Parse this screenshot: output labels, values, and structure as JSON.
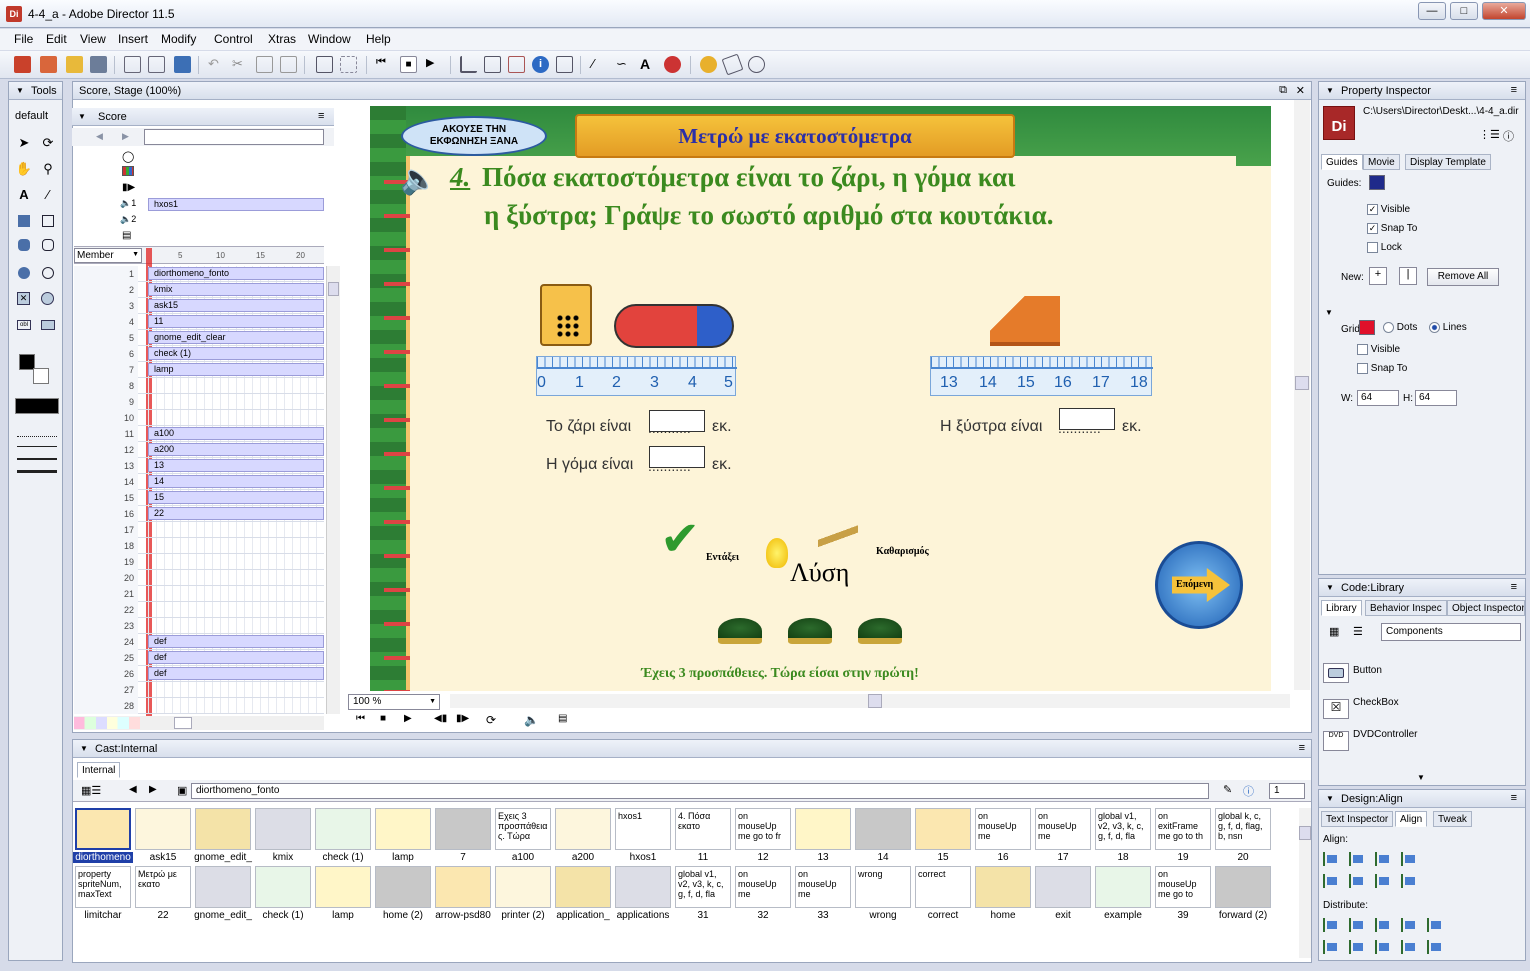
{
  "window": {
    "title": "4-4_a - Adobe Director 11.5",
    "app_icon": "Di"
  },
  "menu": [
    "File",
    "Edit",
    "View",
    "Insert",
    "Modify",
    "Control",
    "Xtras",
    "Window",
    "Help"
  ],
  "tools": {
    "title": "Tools",
    "preset": "default"
  },
  "score": {
    "window_title": "Score, Stage (100%)",
    "panel_title": "Score",
    "member_dropdown": "Member",
    "zoom": "100 %",
    "ruler": [
      "5",
      "10",
      "15",
      "20"
    ],
    "channel_sprite": "hxos1",
    "rows": [
      {
        "n": "1",
        "label": "diorthomeno_fonto"
      },
      {
        "n": "2",
        "label": "kmix"
      },
      {
        "n": "3",
        "label": "ask15"
      },
      {
        "n": "4",
        "label": "11"
      },
      {
        "n": "5",
        "label": "gnome_edit_clear"
      },
      {
        "n": "6",
        "label": "check (1)"
      },
      {
        "n": "7",
        "label": "lamp"
      },
      {
        "n": "8",
        "label": ""
      },
      {
        "n": "9",
        "label": ""
      },
      {
        "n": "10",
        "label": ""
      },
      {
        "n": "11",
        "label": "a100"
      },
      {
        "n": "12",
        "label": "a200"
      },
      {
        "n": "13",
        "label": "13"
      },
      {
        "n": "14",
        "label": "14"
      },
      {
        "n": "15",
        "label": "15"
      },
      {
        "n": "16",
        "label": "22"
      },
      {
        "n": "17",
        "label": ""
      },
      {
        "n": "18",
        "label": ""
      },
      {
        "n": "19",
        "label": ""
      },
      {
        "n": "20",
        "label": ""
      },
      {
        "n": "21",
        "label": ""
      },
      {
        "n": "22",
        "label": ""
      },
      {
        "n": "23",
        "label": ""
      },
      {
        "n": "24",
        "label": "def"
      },
      {
        "n": "25",
        "label": "def"
      },
      {
        "n": "26",
        "label": "def"
      },
      {
        "n": "27",
        "label": ""
      },
      {
        "n": "28",
        "label": ""
      }
    ]
  },
  "stage": {
    "replay_button": "ΑΚΟΥΣΕ ΤΗΝ ΕΚΦΩΝΗΣΗ ΞΑΝΑ",
    "banner": "Μετρώ με εκατοστόμετρα",
    "question_number": "4.",
    "question_line1": "Πόσα εκατοστόμετρα είναι το ζάρι, η γόμα και",
    "question_line2": "η ξύστρα; Γράψε το σωστό αριθμό στα κουτάκια.",
    "ruler_left": [
      "0",
      "1",
      "2",
      "3",
      "4",
      "5"
    ],
    "ruler_right": [
      "13",
      "14",
      "15",
      "16",
      "17",
      "18"
    ],
    "label_die": "Το ζάρι είναι",
    "label_eraser": "Η γόμα είναι",
    "label_sharpener": "Η ξύστρα είναι",
    "dots": "...........",
    "unit": "εκ.",
    "check_label": "Εντάξει",
    "solution_label": "Λύση",
    "clear_label": "Καθαρισμός",
    "next_label": "Επόμενη",
    "attempts": "Έχεις 3 προσπάθειες. Τώρα είσαι στην πρώτη!"
  },
  "cast": {
    "title": "Cast:Internal",
    "tab": "Internal",
    "selected_member": "diorthomeno_fonto",
    "page": "1",
    "row1": [
      {
        "label": "diorthomeno",
        "thumb": ""
      },
      {
        "label": "ask15",
        "thumb": ""
      },
      {
        "label": "gnome_edit_",
        "thumb": ""
      },
      {
        "label": "kmix",
        "thumb": ""
      },
      {
        "label": "check (1)",
        "thumb": ""
      },
      {
        "label": "lamp",
        "thumb": ""
      },
      {
        "label": "7",
        "thumb": ""
      },
      {
        "label": "a100",
        "thumb": "Εχεις 3 προσπάθεια ς. Τώρα"
      },
      {
        "label": "a200",
        "thumb": ""
      },
      {
        "label": "hxos1",
        "thumb": "hxos1"
      },
      {
        "label": "11",
        "thumb": "4. Πόσα εκατο"
      },
      {
        "label": "12",
        "thumb": "on mouseUp me go to fr"
      },
      {
        "label": "13",
        "thumb": ""
      },
      {
        "label": "14",
        "thumb": ""
      },
      {
        "label": "15",
        "thumb": ""
      },
      {
        "label": "16",
        "thumb": "on mouseUp me"
      },
      {
        "label": "17",
        "thumb": "on mouseUp me"
      },
      {
        "label": "18",
        "thumb": "global v1, v2, v3, k, c, g, f, d, fla"
      },
      {
        "label": "19",
        "thumb": "on exitFrame me go to th"
      },
      {
        "label": "20",
        "thumb": "global k, c, g, f, d, flag, b, nsn"
      }
    ],
    "row2": [
      {
        "label": "limitchar",
        "thumb": "property spriteNum, maxText"
      },
      {
        "label": "22",
        "thumb": "Μετρώ με εκατο"
      },
      {
        "label": "gnome_edit_",
        "thumb": ""
      },
      {
        "label": "check (1)",
        "thumb": ""
      },
      {
        "label": "lamp",
        "thumb": ""
      },
      {
        "label": "home (2)",
        "thumb": ""
      },
      {
        "label": "arrow-psd80",
        "thumb": ""
      },
      {
        "label": "printer (2)",
        "thumb": ""
      },
      {
        "label": "application_",
        "thumb": ""
      },
      {
        "label": "applications",
        "thumb": ""
      },
      {
        "label": "31",
        "thumb": "global v1, v2, v3, k, c, g, f, d, fla"
      },
      {
        "label": "32",
        "thumb": "on mouseUp me"
      },
      {
        "label": "33",
        "thumb": "on mouseUp me"
      },
      {
        "label": "wrong",
        "thumb": "wrong"
      },
      {
        "label": "correct",
        "thumb": "correct"
      },
      {
        "label": "home",
        "thumb": ""
      },
      {
        "label": "exit",
        "thumb": ""
      },
      {
        "label": "example",
        "thumb": ""
      },
      {
        "label": "39",
        "thumb": "on mouseUp me go to"
      },
      {
        "label": "forward (2)",
        "thumb": ""
      }
    ]
  },
  "property_inspector": {
    "title": "Property Inspector",
    "path": "C:\\Users\\Director\\Deskt...\\4-4_a.dir",
    "tabs": [
      "Guides",
      "Movie",
      "Display Template"
    ],
    "guides_label": "Guides:",
    "visible": "Visible",
    "snap_to": "Snap To",
    "lock": "Lock",
    "new_label": "New:",
    "remove_all": "Remove All",
    "grid_label": "Grid:",
    "dots": "Dots",
    "lines": "Lines",
    "grid_visible": "Visible",
    "grid_snap": "Snap To",
    "w_label": "W:",
    "w_value": "64",
    "h_label": "H:",
    "h_value": "64"
  },
  "code_library": {
    "title": "Code:Library",
    "tabs": [
      "Library",
      "Behavior Inspec",
      "Object Inspector"
    ],
    "category": "Components",
    "items": [
      "Button",
      "CheckBox",
      "DVDController"
    ]
  },
  "design_align": {
    "title": "Design:Align",
    "tabs": [
      "Text Inspector",
      "Align",
      "Tweak"
    ],
    "align_label": "Align:",
    "distribute_label": "Distribute:"
  },
  "colors": {
    "sprite_fill": "#d7d8ff",
    "stage_bg": "#fdf4d8",
    "green_text": "#3b8a1f",
    "banner_text": "#2b2fa8",
    "playhead": "#e02020"
  }
}
